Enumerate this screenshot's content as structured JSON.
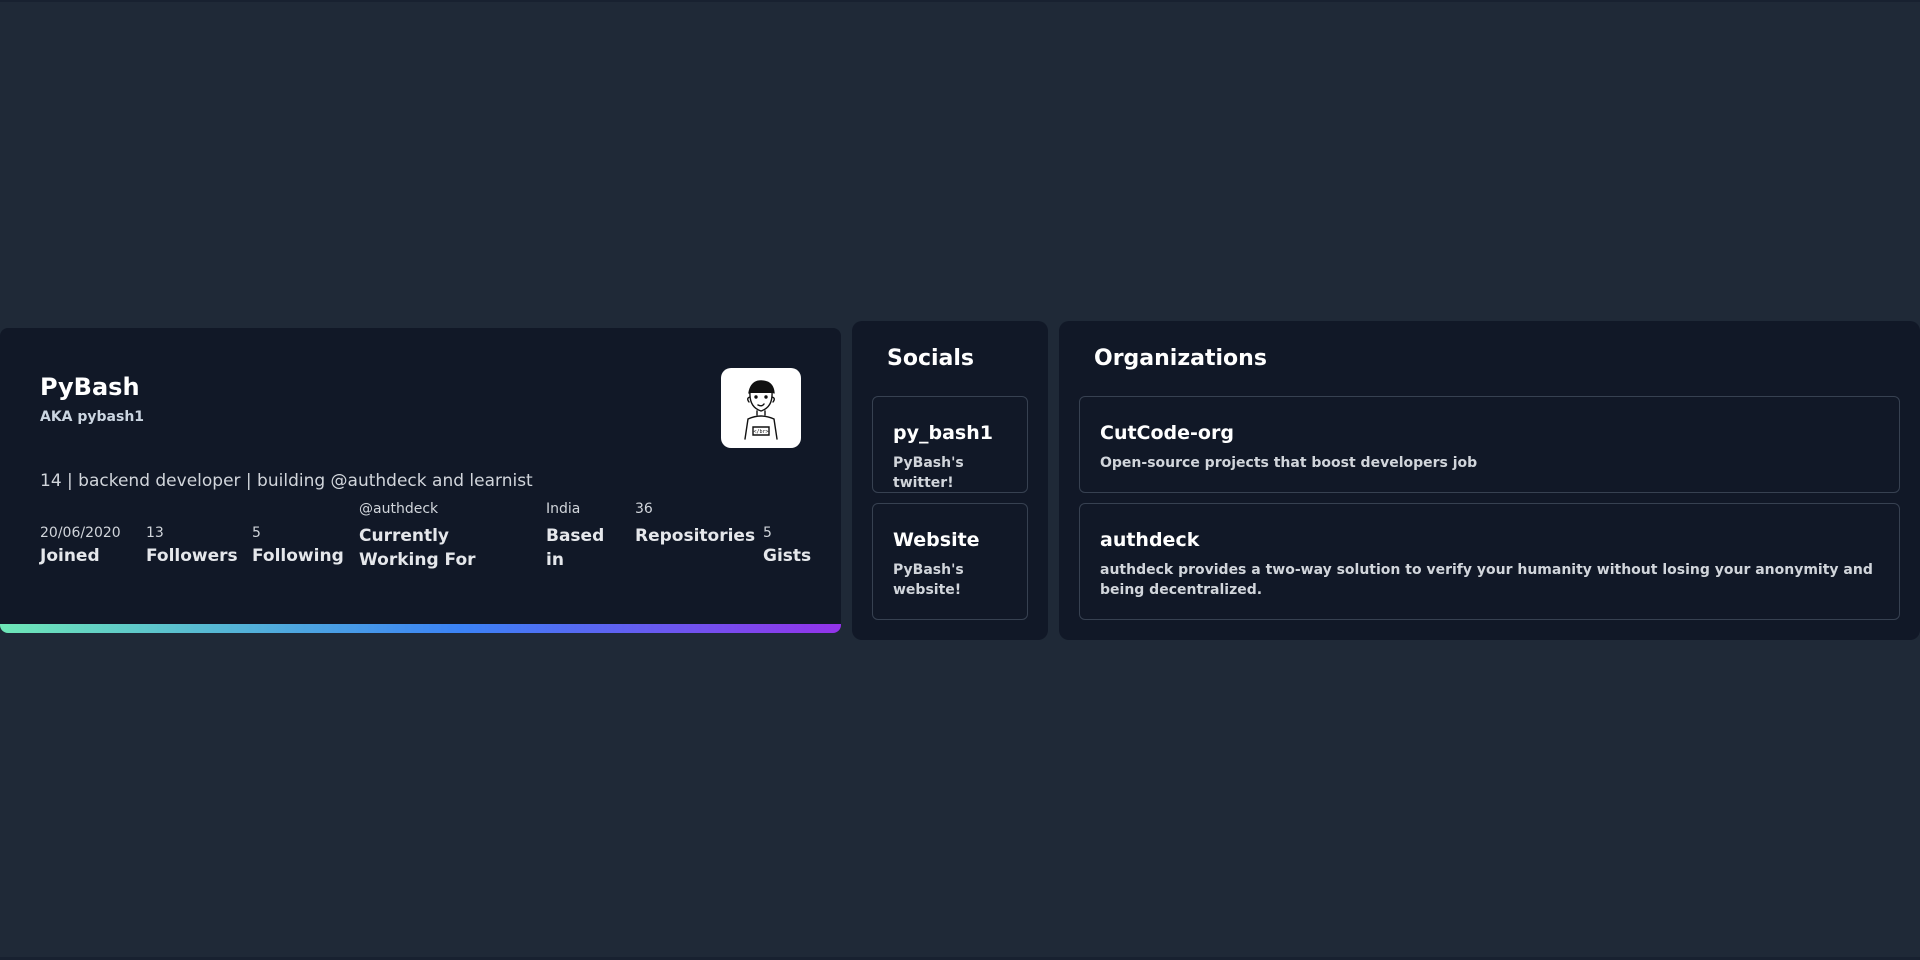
{
  "profile": {
    "name": "PyBash",
    "aka": "AKA pybash1",
    "bio": "14 | backend developer | building @authdeck and learnist",
    "avatar_icon": "cartoon-avatar-icon",
    "stats": [
      {
        "value": "20/06/2020",
        "label": "Joined"
      },
      {
        "value": "13",
        "label": "Followers"
      },
      {
        "value": "5",
        "label": "Following"
      },
      {
        "value": "@authdeck",
        "label": "Currently Working For"
      },
      {
        "value": "India",
        "label": "Based in"
      },
      {
        "value": "36",
        "label": "Repositories"
      },
      {
        "value": "5",
        "label": "Gists"
      }
    ]
  },
  "socials": {
    "title": "Socials",
    "items": [
      {
        "title": "py_bash1",
        "desc": "PyBash's twitter!"
      },
      {
        "title": "Website",
        "desc": "PyBash's website!"
      }
    ]
  },
  "organizations": {
    "title": "Organizations",
    "items": [
      {
        "title": "CutCode-org",
        "desc": "Open-source projects that boost developers job"
      },
      {
        "title": "authdeck",
        "desc": "authdeck provides a two-way solution to verify your humanity without losing your anonymity and being decentralized."
      }
    ]
  },
  "colors": {
    "page_bg": "#1f2937",
    "card_bg": "#111827",
    "border": "#374151",
    "gradient": [
      "#6ee7b7",
      "#3b82f6",
      "#9333ea"
    ]
  }
}
